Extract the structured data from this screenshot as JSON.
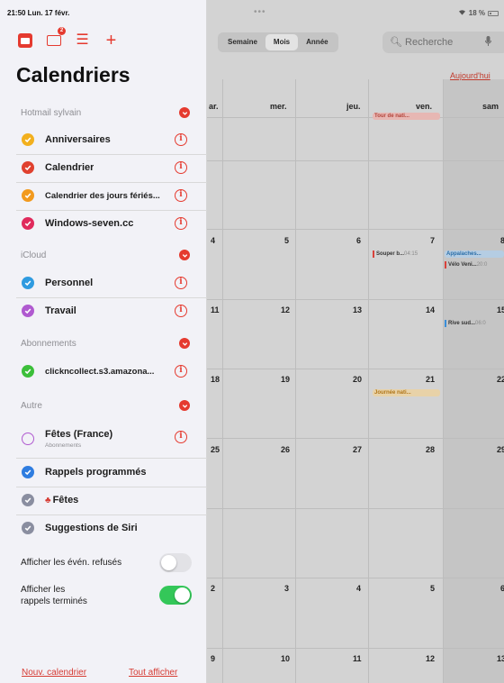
{
  "status_bar": {
    "time": "21:50  Lun. 17 févr.",
    "dots": "•••",
    "battery": "18 %"
  },
  "sidebar": {
    "toolbar_badge": "2",
    "title": "Calendriers",
    "sections": [
      {
        "name": "Hotmail sylvain",
        "items": [
          {
            "label": "Anniversaires",
            "color": "#f2b01e"
          },
          {
            "label": "Calendrier",
            "color": "#e0412f"
          },
          {
            "label": "Calendrier des jours fériés...",
            "color": "#f29a1e"
          },
          {
            "label": "Windows-seven.cc",
            "color": "#e02a5c"
          }
        ]
      },
      {
        "name": "iCloud",
        "items": [
          {
            "label": "Personnel",
            "color": "#2f9be0"
          },
          {
            "label": "Travail",
            "color": "#b05ad0"
          }
        ]
      },
      {
        "name": "Abonnements",
        "items": [
          {
            "label": "clickncollect.s3.amazona...",
            "color": "#3cbf3a"
          }
        ]
      },
      {
        "name": "Autre",
        "items": [
          {
            "label": "Fêtes (France)",
            "sublabel": "Abonnements",
            "color": "#b05ad0"
          },
          {
            "label": "Rappels programmés",
            "color": "#2f7de0"
          },
          {
            "label": "Fêtes",
            "color": "#8a8ea0"
          },
          {
            "label": "Suggestions de Siri",
            "color": "#8a8ea0"
          }
        ]
      }
    ],
    "show_declined_label": "Afficher les événements refusés",
    "show_declined_label_display": "Afficher les évén. refusés",
    "show_declined_on": false,
    "show_completed_label_line1": "Afficher les",
    "show_completed_label_line2": "rappels terminés",
    "show_completed_on": true,
    "new_calendar_link": "Nouv. calendrier",
    "show_all_link": "Tout afficher"
  },
  "calendar": {
    "view_tabs": [
      "Semaine",
      "Mois",
      "Année"
    ],
    "active_tab": "Mois",
    "search_placeholder": "Recherche",
    "today_link": "Aujourd'hui",
    "day_headers": [
      "ar.",
      "mer.",
      "jeu.",
      "ven.",
      "sam"
    ],
    "weeks": [
      [
        "",
        "",
        "",
        "",
        ""
      ],
      [
        "4",
        "5",
        "6",
        "7",
        "8"
      ],
      [
        "11",
        "12",
        "13",
        "14",
        "15"
      ],
      [
        "18",
        "19",
        "20",
        "21",
        "22"
      ],
      [
        "25",
        "26",
        "27",
        "28",
        "29"
      ],
      [
        "2",
        "3",
        "4",
        "5",
        "6"
      ],
      [
        "9",
        "10",
        "11",
        "12",
        "13"
      ]
    ],
    "events": {
      "tour_de_nati": "Tour de nati...",
      "souper": "Souper b...",
      "souper_time": "04:15",
      "appalaches": "Appalaches...",
      "velo": "Vélo Veni...",
      "velo_time": "20:0",
      "rive_sud": "Rive sud...",
      "rive_sud_time": "06:0",
      "journee": "Journée nati..."
    }
  }
}
